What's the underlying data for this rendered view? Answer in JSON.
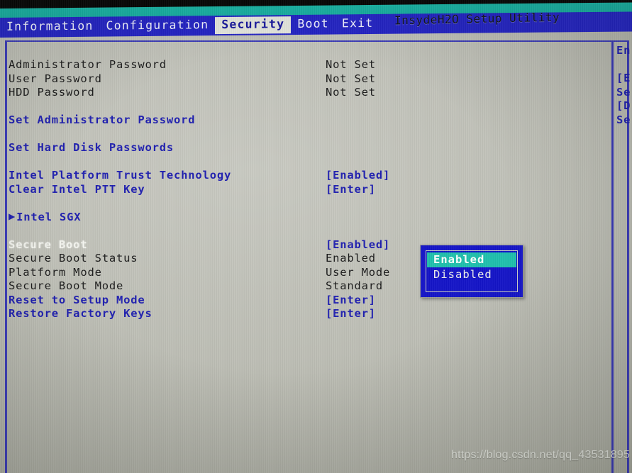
{
  "app": {
    "title": "InsydeH2O Setup Utility"
  },
  "menubar": {
    "items": [
      {
        "label": "Information",
        "active": false
      },
      {
        "label": "Configuration",
        "active": false
      },
      {
        "label": "Security",
        "active": true
      },
      {
        "label": "Boot",
        "active": false
      },
      {
        "label": "Exit",
        "active": false
      }
    ]
  },
  "settings": {
    "rows": [
      {
        "label": "Administrator Password",
        "value": "Not Set",
        "label_style": "c-black",
        "value_style": "c-black",
        "arrow": ""
      },
      {
        "label": "User Password",
        "value": "Not Set",
        "label_style": "c-black",
        "value_style": "c-black",
        "arrow": ""
      },
      {
        "label": "HDD Password",
        "value": "Not Set",
        "label_style": "c-black",
        "value_style": "c-black",
        "arrow": ""
      },
      {
        "label": "",
        "value": "",
        "label_style": "c-black",
        "value_style": "c-black",
        "arrow": ""
      },
      {
        "label": "Set Administrator Password",
        "value": "",
        "label_style": "c-blue",
        "value_style": "c-blue",
        "arrow": ""
      },
      {
        "label": "",
        "value": "",
        "label_style": "c-black",
        "value_style": "c-black",
        "arrow": ""
      },
      {
        "label": "Set Hard Disk Passwords",
        "value": "",
        "label_style": "c-blue",
        "value_style": "c-blue",
        "arrow": ""
      },
      {
        "label": "",
        "value": "",
        "label_style": "c-black",
        "value_style": "c-black",
        "arrow": ""
      },
      {
        "label": "Intel Platform Trust Technology",
        "value": "[Enabled]",
        "label_style": "c-blue",
        "value_style": "c-blue",
        "arrow": ""
      },
      {
        "label": "Clear Intel PTT Key",
        "value": "[Enter]",
        "label_style": "c-blue",
        "value_style": "c-blue",
        "arrow": ""
      },
      {
        "label": "",
        "value": "",
        "label_style": "c-black",
        "value_style": "c-black",
        "arrow": ""
      },
      {
        "label": "Intel SGX",
        "value": "",
        "label_style": "c-blue",
        "value_style": "c-blue",
        "arrow": "▶"
      },
      {
        "label": "",
        "value": "",
        "label_style": "c-black",
        "value_style": "c-black",
        "arrow": ""
      },
      {
        "label": "Secure Boot",
        "value": "[Enabled]",
        "label_style": "c-white",
        "value_style": "c-blue",
        "arrow": ""
      },
      {
        "label": "Secure Boot Status",
        "value": "Enabled",
        "label_style": "c-black",
        "value_style": "c-black",
        "arrow": ""
      },
      {
        "label": "Platform Mode",
        "value": "User Mode",
        "label_style": "c-black",
        "value_style": "c-black",
        "arrow": ""
      },
      {
        "label": "Secure Boot Mode",
        "value": "Standard",
        "label_style": "c-black",
        "value_style": "c-black",
        "arrow": ""
      },
      {
        "label": "Reset to Setup Mode",
        "value": "[Enter]",
        "label_style": "c-blue",
        "value_style": "c-blue",
        "arrow": ""
      },
      {
        "label": "Restore Factory Keys",
        "value": "[Enter]",
        "label_style": "c-blue",
        "value_style": "c-blue",
        "arrow": ""
      }
    ]
  },
  "dropdown": {
    "name": "secure-boot-options",
    "options": [
      {
        "label": "Enabled",
        "selected": true
      },
      {
        "label": "Disabled",
        "selected": false
      }
    ]
  },
  "help_pane": {
    "lines": [
      "En",
      "",
      "[E",
      "Se",
      "[D",
      "Se"
    ]
  },
  "watermark": {
    "text": "https://blog.csdn.net/qq_43531895"
  },
  "colors": {
    "menubar_blue": "#2323c4",
    "teal_band": "#16ada0",
    "panel_gray": "#bdbeb5",
    "accent_blue": "#1f1fb0",
    "highlight_teal": "#1fc0ad",
    "dropdown_blue": "#1414c8"
  }
}
